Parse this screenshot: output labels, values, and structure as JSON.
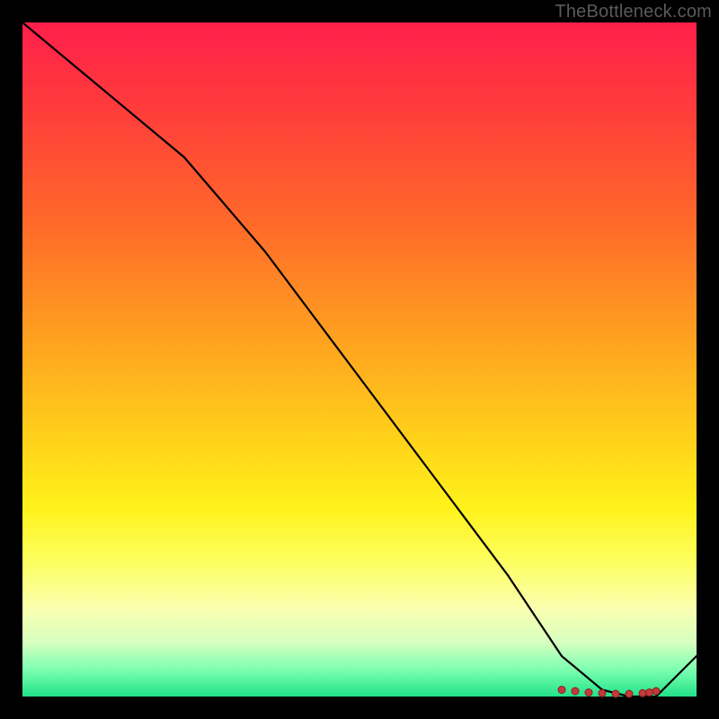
{
  "watermark": "TheBottleneck.com",
  "chart_data": {
    "type": "line",
    "title": "",
    "xlabel": "",
    "ylabel": "",
    "xlim": [
      0,
      100
    ],
    "ylim": [
      0,
      100
    ],
    "grid": false,
    "legend": false,
    "series": [
      {
        "name": "bottleneck-curve",
        "x": [
          0,
          12,
          24,
          36,
          48,
          60,
          72,
          80,
          86,
          90,
          94,
          100
        ],
        "y": [
          100,
          90,
          80,
          66,
          50,
          34,
          18,
          6,
          1,
          0,
          0,
          6
        ]
      }
    ],
    "markers": {
      "name": "sweet-spot-dots",
      "x": [
        80,
        82,
        84,
        86,
        88,
        90,
        92,
        93,
        94
      ],
      "y": [
        1.0,
        0.8,
        0.6,
        0.5,
        0.4,
        0.4,
        0.5,
        0.6,
        0.8
      ]
    },
    "background": "rainbow-vertical-red-to-green",
    "notes": "Values are read in percent of the plot-area dimensions; y=0 is the bottom edge (green), y=100 is the top edge (red). No numeric axis labels are visible in the image."
  }
}
